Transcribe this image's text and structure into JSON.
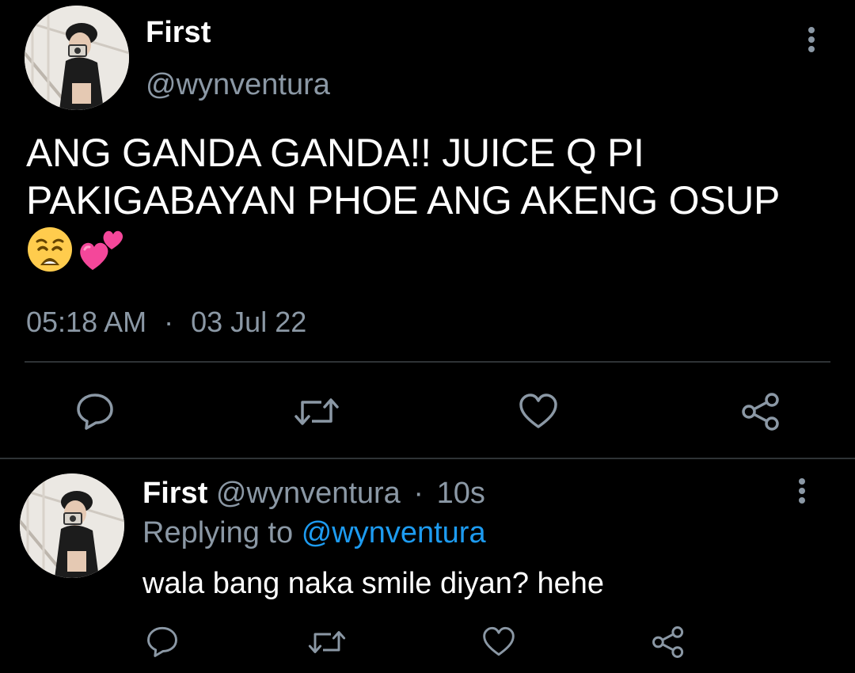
{
  "colors": {
    "background": "#000000",
    "text_primary": "#ffffff",
    "text_secondary": "#8b98a5",
    "accent_link": "#1d9bf0",
    "divider": "#2f3336"
  },
  "main_tweet": {
    "author_name": "First",
    "author_handle": "@wynventura",
    "text_line_1": "ANG GANDA GANDA!! JUICE Q PI",
    "text_line_2": "PAKIGABAYAN PHOE ANG AKENG OSUP",
    "emojis": [
      "weary-face-emoji",
      "two-hearts-emoji"
    ],
    "time": "05:18 AM",
    "separator": "·",
    "date": "03 Jul 22",
    "actions": [
      "reply-icon",
      "retweet-icon",
      "like-icon",
      "share-icon"
    ]
  },
  "reply_tweet": {
    "author_name": "First",
    "author_handle": "@wynventura",
    "separator": "·",
    "time_ago": "10s",
    "replying_to_label": "Replying to",
    "replying_to_handle": "@wynventura",
    "text": "wala bang naka smile diyan? hehe",
    "actions": [
      "reply-icon",
      "retweet-icon",
      "like-icon",
      "share-icon"
    ]
  }
}
